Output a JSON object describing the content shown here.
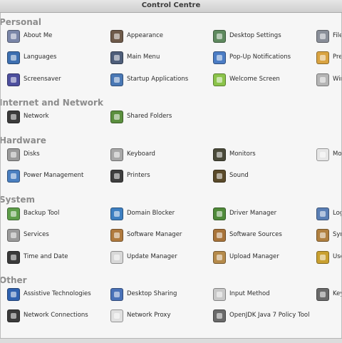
{
  "window": {
    "title": "Control Centre"
  },
  "sections": [
    {
      "heading": "Personal",
      "rows": [
        [
          {
            "label": "About Me",
            "icon": "about-me-icon",
            "color": "#7a86a8"
          },
          {
            "label": "Appearance",
            "icon": "appearance-icon",
            "color": "#6e5a4a"
          },
          {
            "label": "Desktop Settings",
            "icon": "desktop-settings-icon",
            "color": "#5f8a5f"
          },
          {
            "label": "File",
            "icon": "file-icon",
            "color": "#8a8f99"
          }
        ],
        [
          {
            "label": "Languages",
            "icon": "languages-icon",
            "color": "#3d6fb0"
          },
          {
            "label": "Main Menu",
            "icon": "main-menu-icon",
            "color": "#4e5e7a"
          },
          {
            "label": "Pop-Up Notifications",
            "icon": "popup-notifications-icon",
            "color": "#4b7cc4"
          },
          {
            "label": "Pref",
            "icon": "preferences-icon",
            "color": "#d9a341"
          }
        ],
        [
          {
            "label": "Screensaver",
            "icon": "screensaver-icon",
            "color": "#4d4f9e"
          },
          {
            "label": "Startup Applications",
            "icon": "startup-applications-icon",
            "color": "#4a78b5"
          },
          {
            "label": "Welcome Screen",
            "icon": "welcome-screen-icon",
            "color": "#8bc34a"
          },
          {
            "label": "Win",
            "icon": "windows-icon",
            "color": "#b5b5b5"
          }
        ]
      ]
    },
    {
      "heading": "Internet and Network",
      "rows": [
        [
          {
            "label": "Network",
            "icon": "network-icon",
            "color": "#3b3b3b"
          },
          {
            "label": "Shared Folders",
            "icon": "shared-folders-icon",
            "color": "#5b8f3e"
          }
        ]
      ]
    },
    {
      "heading": "Hardware",
      "rows": [
        [
          {
            "label": "Disks",
            "icon": "disks-icon",
            "color": "#9a9a9a"
          },
          {
            "label": "Keyboard",
            "icon": "keyboard-icon",
            "color": "#a8a8a8"
          },
          {
            "label": "Monitors",
            "icon": "monitors-icon",
            "color": "#4a4a3a"
          },
          {
            "label": "Mou",
            "icon": "mouse-icon",
            "color": "#e6e6e6"
          }
        ],
        [
          {
            "label": "Power Management",
            "icon": "power-management-icon",
            "color": "#4a7fc0"
          },
          {
            "label": "Printers",
            "icon": "printers-icon",
            "color": "#3f3f3f"
          },
          {
            "label": "Sound",
            "icon": "sound-icon",
            "color": "#5a4a2a"
          }
        ]
      ]
    },
    {
      "heading": "System",
      "rows": [
        [
          {
            "label": "Backup Tool",
            "icon": "backup-tool-icon",
            "color": "#5e9e4a"
          },
          {
            "label": "Domain Blocker",
            "icon": "domain-blocker-icon",
            "color": "#3e7fc1"
          },
          {
            "label": "Driver Manager",
            "icon": "driver-manager-icon",
            "color": "#4f8a3a"
          },
          {
            "label": "Log",
            "icon": "log-icon",
            "color": "#5a7fb5"
          }
        ],
        [
          {
            "label": "Services",
            "icon": "services-icon",
            "color": "#9a9a9a"
          },
          {
            "label": "Software Manager",
            "icon": "software-manager-icon",
            "color": "#b07a3e"
          },
          {
            "label": "Software Sources",
            "icon": "software-sources-icon",
            "color": "#a8743a"
          },
          {
            "label": "Syn",
            "icon": "synaptic-icon",
            "color": "#b08040"
          }
        ],
        [
          {
            "label": "Time and Date",
            "icon": "time-and-date-icon",
            "color": "#3a3a3a"
          },
          {
            "label": "Update Manager",
            "icon": "update-manager-icon",
            "color": "#d8d8d8"
          },
          {
            "label": "Upload Manager",
            "icon": "upload-manager-icon",
            "color": "#b58a4a"
          },
          {
            "label": "Use",
            "icon": "users-icon",
            "color": "#c9a030"
          }
        ]
      ]
    },
    {
      "heading": "Other",
      "rows": [
        [
          {
            "label": "Assistive Technologies",
            "icon": "assistive-technologies-icon",
            "color": "#2f62b0"
          },
          {
            "label": "Desktop Sharing",
            "icon": "desktop-sharing-icon",
            "color": "#4a72b8"
          },
          {
            "label": "Input Method",
            "icon": "input-method-icon",
            "color": "#c8c8c8"
          },
          {
            "label": "Key",
            "icon": "keyring-icon",
            "color": "#6a6a6a"
          }
        ],
        [
          {
            "label": "Network Connections",
            "icon": "network-connections-icon",
            "color": "#3b3b3b"
          },
          {
            "label": "Network Proxy",
            "icon": "network-proxy-icon",
            "color": "#e0e0e0"
          },
          {
            "label": "OpenJDK Java 7 Policy Tool",
            "icon": "java-policy-tool-icon",
            "color": "#6a6a6a"
          }
        ]
      ]
    }
  ]
}
